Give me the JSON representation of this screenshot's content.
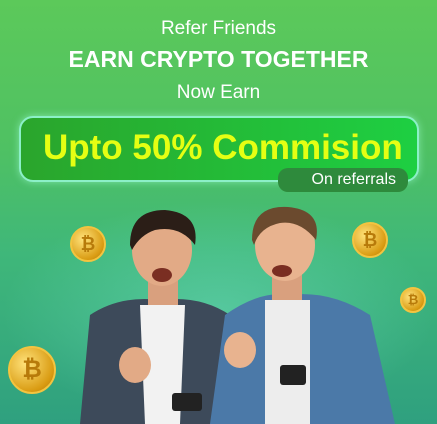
{
  "header": {
    "line1": "Refer Friends",
    "line2": "EARN CRYPTO TOGETHER",
    "line3": "Now Earn"
  },
  "offer": {
    "headline": "Upto 50% Commision",
    "badge": "On referrals"
  },
  "colors": {
    "accent": "#e5ff13",
    "box": "#1ecf42"
  },
  "icons": {
    "coin": "₿"
  }
}
